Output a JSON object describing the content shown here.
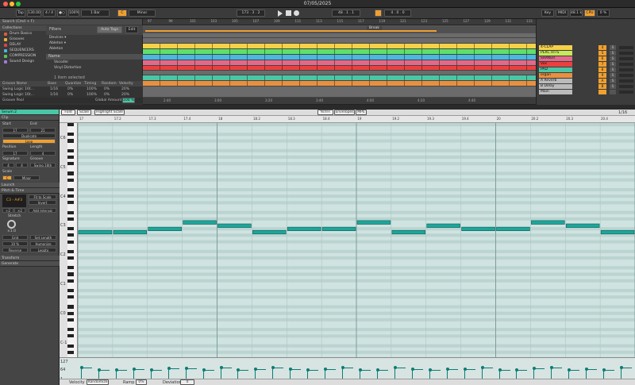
{
  "window": {
    "title": "07/05/2025"
  },
  "transport": {
    "tap": "Tap",
    "tempo": "130.00",
    "signature": "4 / 4",
    "metronome": "●○",
    "zoom": "100%",
    "quantize": "1 Bar",
    "key_root": "C",
    "scale": "Minor",
    "position": "173 . 3 . 2",
    "loop_start": "48 . 1 . 1",
    "loop_length": "4 . 0 . 0",
    "key_btn": "Key",
    "midi_btn": "MIDI",
    "sample_rate": "48.1 kHz",
    "cpu": "CPU",
    "cpu_val": "0 %"
  },
  "browser": {
    "search_placeholder": "Search (Cmd + F)",
    "collections_header": "Collections",
    "filters_header": "Filters",
    "auto_tags": "Auto Tags",
    "edit": "Edit",
    "collections": [
      {
        "label": "Drum Basics",
        "color": "#e05c3a"
      },
      {
        "label": "Grooves",
        "color": "#e8b03a"
      },
      {
        "label": "DELAY",
        "color": "#d44"
      },
      {
        "label": "SEQUENCERS",
        "color": "#4ab8e0"
      },
      {
        "label": "COMPRESSION",
        "color": "#59c45b"
      },
      {
        "label": "Sound Design",
        "color": "#a07ad8"
      }
    ],
    "filter_cats": [
      "Devices ▾",
      "Ableton ▾",
      "Ableton"
    ],
    "name_col": "Name",
    "items": [
      "Vocoder",
      "Vinyl Distortion"
    ],
    "selected_count": "1 item selected"
  },
  "groove": {
    "header": "Groove Name",
    "cols": [
      "Base",
      "Quantize",
      "Timing",
      "Random",
      "Velocity"
    ],
    "rows": [
      {
        "name": "Swing Logic 16t...",
        "base": "1/16",
        "quantize": "0%",
        "timing": "100%",
        "random": "0%",
        "velocity": "20%"
      },
      {
        "name": "Swing Logic 16t...",
        "base": "1/16",
        "quantize": "0%",
        "timing": "100%",
        "random": "0%",
        "velocity": "20%"
      }
    ],
    "pool": "Groove Pool",
    "global_amount": "Global Amount",
    "global_val": "100 %"
  },
  "arrangement": {
    "ruler": [
      "97",
      "99",
      "101",
      "103",
      "105",
      "107",
      "109",
      "111",
      "113",
      "115",
      "117",
      "119",
      "121",
      "123",
      "125",
      "127",
      "129",
      "131",
      "133"
    ],
    "time_ruler": [
      "2:40",
      "3:00",
      "3:20",
      "3:40",
      "4:00",
      "4:20",
      "4:40"
    ],
    "locator": "Break"
  },
  "mixer": {
    "tracks": [
      {
        "name": "4-CLAP",
        "color": "#f5d04a",
        "num": "4",
        "s": "S"
      },
      {
        "name": "PERC HITS",
        "color": "#c6e85a",
        "num": "5",
        "s": "S"
      },
      {
        "name": "SHAKER",
        "color": "#e06a8a",
        "num": "6",
        "s": "S"
      },
      {
        "name": "Vox",
        "color": "#ec4040",
        "num": "7",
        "s": "S"
      },
      {
        "name": "PAD",
        "color": "#4ac6a6",
        "num": "8",
        "s": "S"
      },
      {
        "name": "organ",
        "color": "#e89040",
        "num": "9",
        "s": "S"
      },
      {
        "name": "A Reverb",
        "color": "#bbb",
        "num": "A",
        "s": "S"
      },
      {
        "name": "B Delay",
        "color": "#bbb",
        "num": "B",
        "s": "S"
      },
      {
        "name": "Main",
        "color": "#bbb",
        "num": "",
        "s": ""
      }
    ]
  },
  "clip": {
    "title": "Serum 2",
    "clip_hd": "Clip",
    "start": "Start",
    "end": "End",
    "start_val": "17",
    "end_val": "21",
    "duplicate": "Duplicate",
    "loop": "Loop",
    "position": "Position",
    "length": "Length",
    "pos_val": "17",
    "len_val": "4",
    "signature": "Signature",
    "groove": "Groove",
    "sig_a": "4",
    "sig_b": "4",
    "groove_val": "Swing 16th",
    "scale": "Scale",
    "scale_root": "C",
    "scale_name": "Minor",
    "launch": "Launch",
    "pitch_time": "Pitch & Time",
    "range": "C3 - A#3",
    "fit": "Fit to Scale",
    "invert": "Invert",
    "x2": "÷2",
    "x2b": "×2",
    "add_interval": "Add Interval",
    "stretch": "Stretch",
    "stretch_val": "×1.0",
    "grid": "Grid",
    "set_length": "Set Length",
    "humanize_val": "10 %",
    "humanize": "Humanize",
    "reverse": "Reverse",
    "legato": "Legato",
    "transform": "Transform",
    "generate": "Generate"
  },
  "editor": {
    "fold": "Fold",
    "scale": "Scale",
    "highlight": "Highlight Scale",
    "tab_notes": "Notes",
    "tab_envelopes": "Envelopes",
    "tab_mpe": "MPE",
    "grid_label": "1/16",
    "ruler": [
      "17",
      "17.2",
      "17.3",
      "17.4",
      "18",
      "18.2",
      "18.3",
      "18.4",
      "19",
      "19.2",
      "19.3",
      "19.4",
      "20",
      "20.2",
      "20.3",
      "20.4"
    ],
    "octaves": [
      "C6",
      "C5",
      "C4",
      "C3",
      "C2",
      "C1",
      "C0",
      "C-1",
      "C-2"
    ],
    "vel_max": "127",
    "vel_mid": "64",
    "vel_min": "1",
    "velocity": "Velocity",
    "randomize": "Randomize",
    "ramp": "Ramp",
    "ramp_val": "0%",
    "deviation": "Deviation",
    "dev_val": "0"
  },
  "notes": [
    {
      "b": 0.0,
      "l": 0.25,
      "p": 69
    },
    {
      "b": 0.25,
      "l": 0.25,
      "p": 69
    },
    {
      "b": 0.5,
      "l": 0.25,
      "p": 70
    },
    {
      "b": 0.75,
      "l": 0.25,
      "p": 72
    },
    {
      "b": 1.0,
      "l": 0.25,
      "p": 71
    },
    {
      "b": 1.25,
      "l": 0.25,
      "p": 69
    },
    {
      "b": 1.5,
      "l": 0.25,
      "p": 70
    },
    {
      "b": 1.75,
      "l": 0.25,
      "p": 70
    },
    {
      "b": 2.0,
      "l": 0.25,
      "p": 72
    },
    {
      "b": 2.25,
      "l": 0.25,
      "p": 69
    },
    {
      "b": 2.5,
      "l": 0.25,
      "p": 71
    },
    {
      "b": 2.75,
      "l": 0.25,
      "p": 70
    },
    {
      "b": 3.0,
      "l": 0.25,
      "p": 70
    },
    {
      "b": 3.25,
      "l": 0.25,
      "p": 72
    },
    {
      "b": 3.5,
      "l": 0.25,
      "p": 71
    },
    {
      "b": 3.75,
      "l": 0.25,
      "p": 69
    }
  ],
  "velocities": [
    100,
    82,
    85,
    86,
    83,
    92,
    95,
    82,
    100,
    84,
    86,
    100,
    86,
    84,
    90,
    100,
    82,
    85,
    100,
    90,
    84,
    90,
    86,
    100,
    83,
    82,
    92,
    100,
    84,
    86,
    82,
    100
  ]
}
